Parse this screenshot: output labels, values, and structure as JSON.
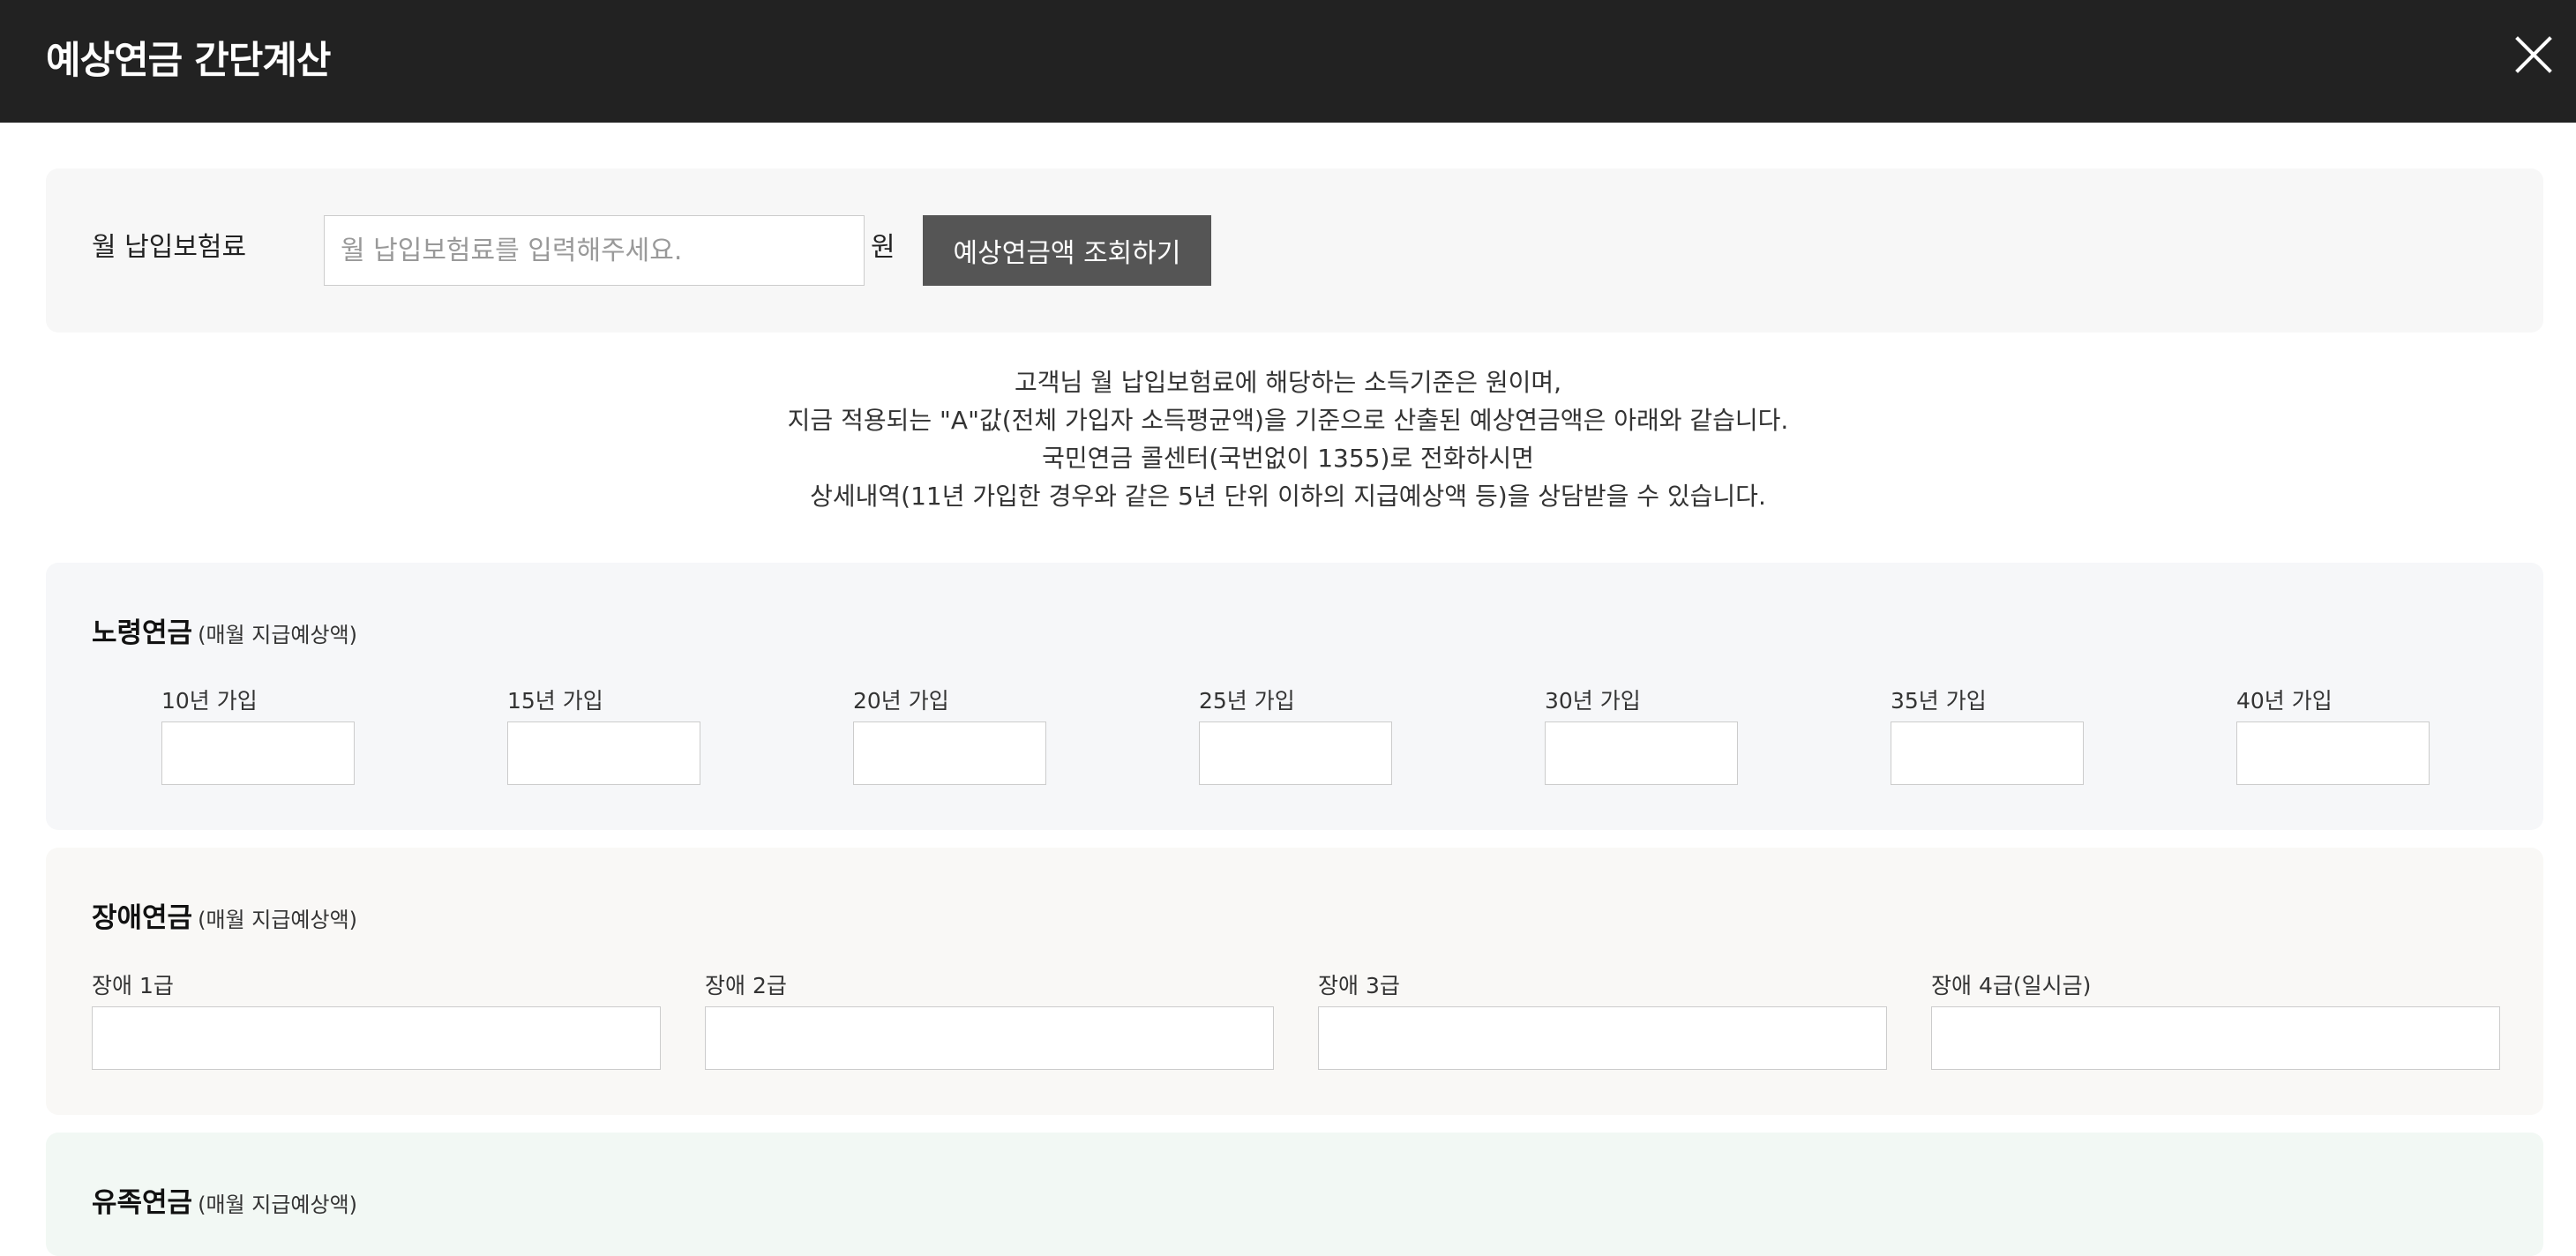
{
  "header": {
    "title": "예상연금 간단계산",
    "close_icon": "close-icon"
  },
  "premium": {
    "label": "월 납입보험료",
    "placeholder": "월 납입보험료를 입력해주세요.",
    "value": "",
    "unit": "원",
    "query_button": "예상연금액 조회하기"
  },
  "notice": {
    "lines": [
      "고객님 월 납입보험료에 해당하는 소득기준은 원이며,",
      "지금 적용되는 \"A\"값(전체 가입자 소득평균액)을 기준으로 산출된 예상연금액은 아래와 같습니다.",
      "국민연금 콜센터(국번없이 1355)로 전화하시면",
      "상세내역(11년 가입한 경우와 같은 5년 단위 이하의 지급예상액 등)을 상담받을 수 있습니다."
    ]
  },
  "old_age": {
    "title": "노령연금",
    "subtitle": "(매월 지급예상액)",
    "fields": [
      {
        "label": "10년 가입",
        "value": ""
      },
      {
        "label": "15년 가입",
        "value": ""
      },
      {
        "label": "20년 가입",
        "value": ""
      },
      {
        "label": "25년 가입",
        "value": ""
      },
      {
        "label": "30년 가입",
        "value": ""
      },
      {
        "label": "35년 가입",
        "value": ""
      },
      {
        "label": "40년 가입",
        "value": ""
      }
    ]
  },
  "disability": {
    "title": "장애연금",
    "subtitle": "(매월 지급예상액)",
    "fields": [
      {
        "label": "장애 1급",
        "value": ""
      },
      {
        "label": "장애 2급",
        "value": ""
      },
      {
        "label": "장애 3급",
        "value": ""
      },
      {
        "label": "장애 4급(일시금)",
        "value": ""
      }
    ]
  },
  "survivor": {
    "title": "유족연금",
    "subtitle": "(매월 지급예상액)"
  }
}
